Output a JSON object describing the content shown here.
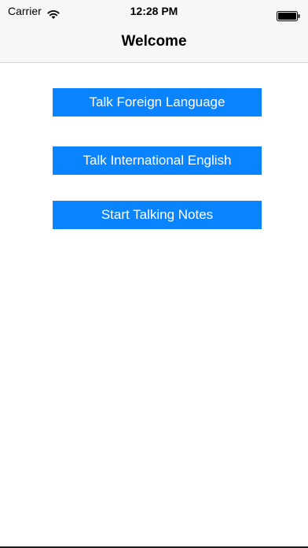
{
  "status_bar": {
    "carrier": "Carrier",
    "time": "12:28 PM",
    "wifi_icon": "wifi-icon",
    "battery_icon": "battery-icon"
  },
  "nav_bar": {
    "title": "Welcome"
  },
  "buttons": [
    {
      "label": "Talk Foreign Language"
    },
    {
      "label": "Talk International English"
    },
    {
      "label": "Start Talking Notes"
    }
  ],
  "colors": {
    "button_background": "#0a83ff",
    "button_text": "#ffffff",
    "bar_background": "#f7f7f8"
  }
}
